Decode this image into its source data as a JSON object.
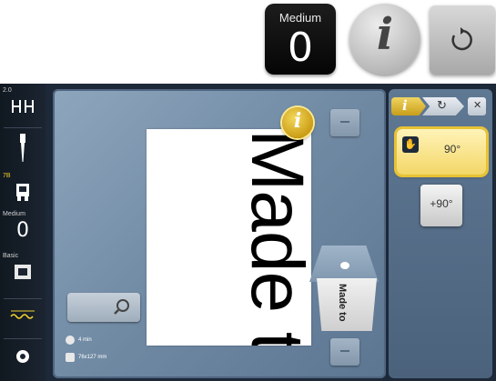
{
  "top_toolbar": {
    "presser_foot_pressure": {
      "label": "Medium",
      "value": "0"
    },
    "info_icon": "i",
    "reset_icon": "reset-arrow-icon"
  },
  "left_sidebar": {
    "stitch_width_value": "2.0",
    "needle_label": "7B",
    "presser_foot_label": "Medium",
    "presser_foot_value": "0",
    "feed_label": "Basic",
    "presser_foot_small": "0"
  },
  "canvas": {
    "embroidery_text": "Made to",
    "info_icon": "i",
    "stitch_time": "4 min",
    "design_size": "76x127 mm"
  },
  "preview": {
    "card_text": "Made to"
  },
  "right_panel": {
    "tabs": {
      "info": "i",
      "reset": "↻",
      "close": "✕"
    },
    "rotate_button_label": "90°",
    "rotate_plus_label": "+90°"
  },
  "colors": {
    "screen_bg": "#1d2838",
    "canvas_bg": "#7a93ac",
    "accent_yellow": "#f3d767",
    "panel_bg": "#56708b"
  }
}
